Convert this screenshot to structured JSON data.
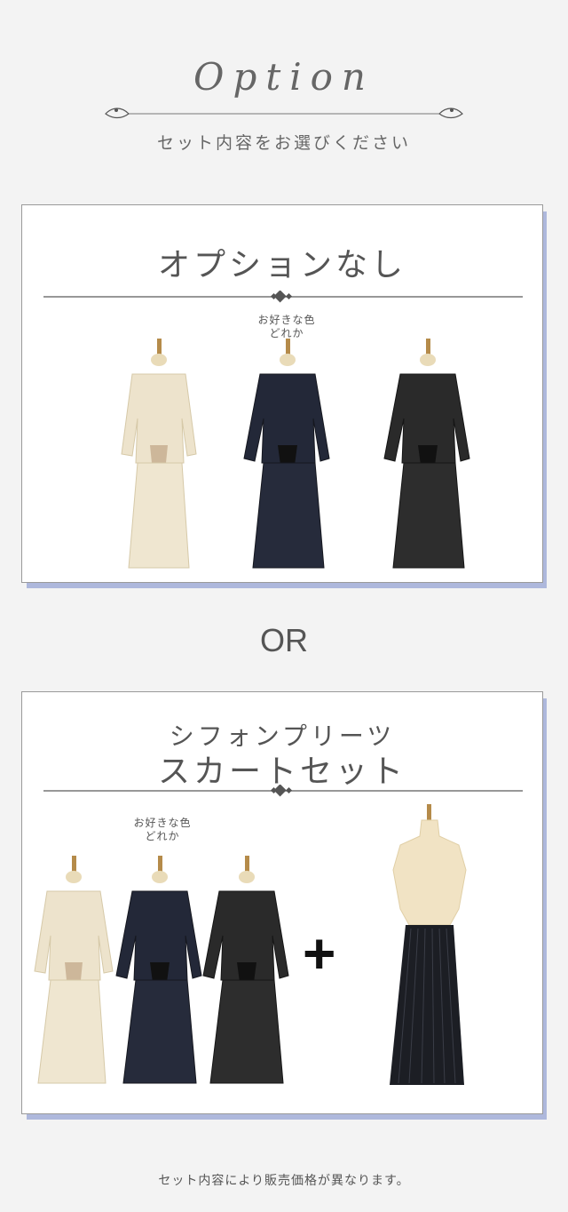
{
  "header": {
    "title": "Option",
    "subtitle": "セット内容をお選びください"
  },
  "option1": {
    "title": "オプションなし",
    "tag_line1": "お好きな色",
    "tag_line2": "どれか",
    "items": [
      {
        "name": "beige-lace-suit",
        "color": "#ede3cc"
      },
      {
        "name": "navy-lace-suit",
        "color": "#232838"
      },
      {
        "name": "black-lace-suit",
        "color": "#2a2a2a"
      }
    ]
  },
  "or_label": "OR",
  "option2": {
    "title_line1": "シフォンプリーツ",
    "title_line2": "スカートセット",
    "tag_line1": "お好きな色",
    "tag_line2": "どれか",
    "plus": "+",
    "items": [
      {
        "name": "beige-lace-suit",
        "color": "#ede3cc"
      },
      {
        "name": "navy-lace-suit",
        "color": "#232838"
      },
      {
        "name": "black-lace-suit",
        "color": "#2a2a2a"
      }
    ],
    "skirt_color": "#1c1e24"
  },
  "footer": "セット内容により販売価格が異なります。",
  "colors": {
    "background": "#f3f3f3",
    "panel_shadow": "#aeb8dc",
    "panel_border": "#9a9a9a"
  }
}
